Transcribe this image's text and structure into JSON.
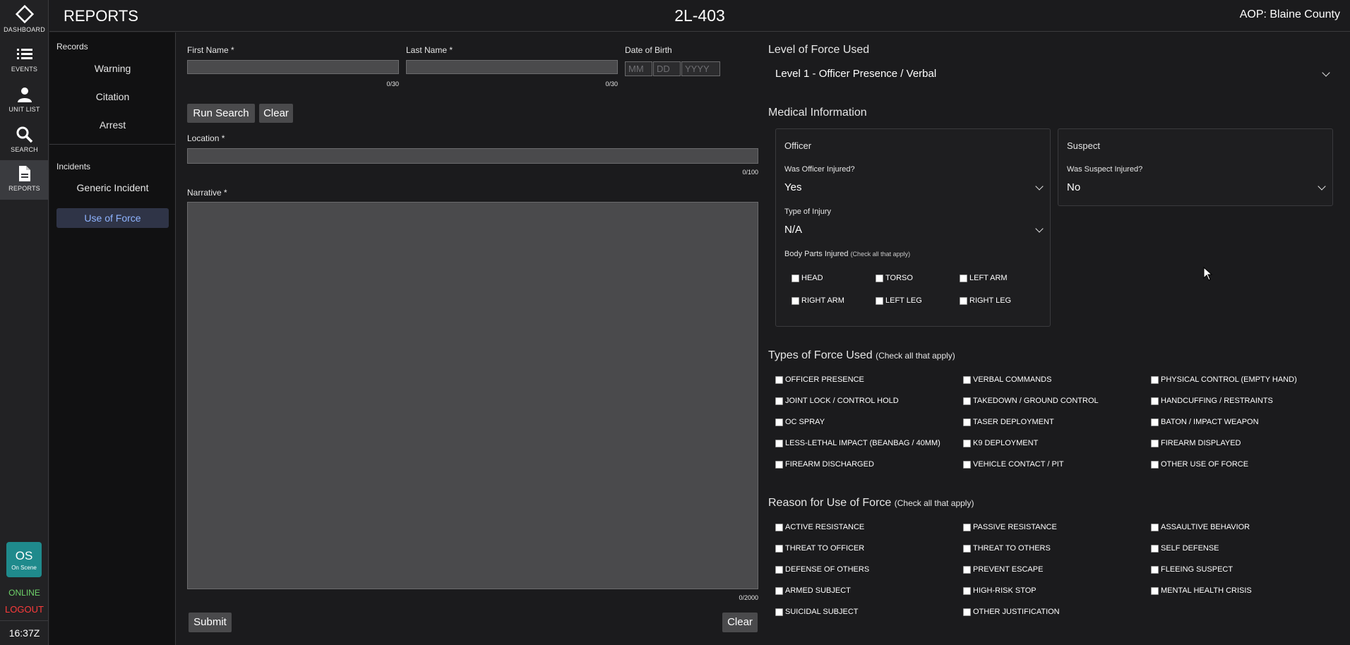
{
  "rail": {
    "items": [
      {
        "label": "DASHBOARD",
        "icon": "diamond-icon"
      },
      {
        "label": "EVENTS",
        "icon": "list-icon"
      },
      {
        "label": "UNIT LIST",
        "icon": "person-icon"
      },
      {
        "label": "SEARCH",
        "icon": "search-icon"
      },
      {
        "label": "REPORTS",
        "icon": "document-icon"
      }
    ],
    "status_badge": {
      "code": "OS",
      "text": "On Scene"
    },
    "online": "ONLINE",
    "logout": "LOGOUT",
    "clock": "16:37Z"
  },
  "header": {
    "title": "REPORTS",
    "unit": "2L-403",
    "aop": "AOP: Blaine County"
  },
  "subnav": {
    "records_heading": "Records",
    "records": [
      "Warning",
      "Citation",
      "Arrest"
    ],
    "incidents_heading": "Incidents",
    "incidents": [
      "Generic Incident",
      "Use of Force"
    ]
  },
  "form": {
    "first_name_label": "First Name *",
    "first_name_counter": "0/30",
    "last_name_label": "Last Name *",
    "last_name_counter": "0/30",
    "dob_label": "Date of Birth",
    "dob_placeholders": [
      "MM",
      "DD",
      "YYYY"
    ],
    "run_search": "Run Search",
    "clear": "Clear",
    "location_label": "Location *",
    "location_counter": "0/100",
    "narrative_label": "Narrative *",
    "narrative_counter": "0/2000",
    "submit": "Submit",
    "clear_bottom": "Clear"
  },
  "force": {
    "level_label": "Level of Force Used",
    "level_value": "Level 1 - Officer Presence / Verbal"
  },
  "medical": {
    "heading": "Medical Information",
    "officer": {
      "title": "Officer",
      "injured_label": "Was Officer Injured?",
      "injured_value": "Yes",
      "injury_type_label": "Type of Injury",
      "injury_type_value": "N/A",
      "body_parts_label": "Body Parts Injured",
      "body_parts_hint": "(Check all that apply)",
      "body_parts": [
        "HEAD",
        "TORSO",
        "LEFT ARM",
        "RIGHT ARM",
        "LEFT LEG",
        "RIGHT LEG"
      ]
    },
    "suspect": {
      "title": "Suspect",
      "injured_label": "Was Suspect Injured?",
      "injured_value": "No"
    }
  },
  "types_of_force": {
    "heading": "Types of Force Used",
    "hint": "(Check all that apply)",
    "options": [
      "OFFICER PRESENCE",
      "VERBAL COMMANDS",
      "PHYSICAL CONTROL (EMPTY HAND)",
      "JOINT LOCK / CONTROL HOLD",
      "TAKEDOWN / GROUND CONTROL",
      "HANDCUFFING / RESTRAINTS",
      "OC SPRAY",
      "TASER DEPLOYMENT",
      "BATON / IMPACT WEAPON",
      "LESS-LETHAL IMPACT (BEANBAG / 40MM)",
      "K9 DEPLOYMENT",
      "FIREARM DISPLAYED",
      "FIREARM DISCHARGED",
      "VEHICLE CONTACT / PIT",
      "OTHER USE OF FORCE"
    ]
  },
  "reasons": {
    "heading": "Reason for Use of Force",
    "hint": "(Check all that apply)",
    "options": [
      "ACTIVE RESISTANCE",
      "PASSIVE RESISTANCE",
      "ASSAULTIVE BEHAVIOR",
      "THREAT TO OFFICER",
      "THREAT TO OTHERS",
      "SELF DEFENSE",
      "DEFENSE OF OTHERS",
      "PREVENT ESCAPE",
      "FLEEING SUSPECT",
      "ARMED SUBJECT",
      "HIGH-RISK STOP",
      "MENTAL HEALTH CRISIS",
      "SUICIDAL SUBJECT",
      "OTHER JUSTIFICATION"
    ]
  }
}
